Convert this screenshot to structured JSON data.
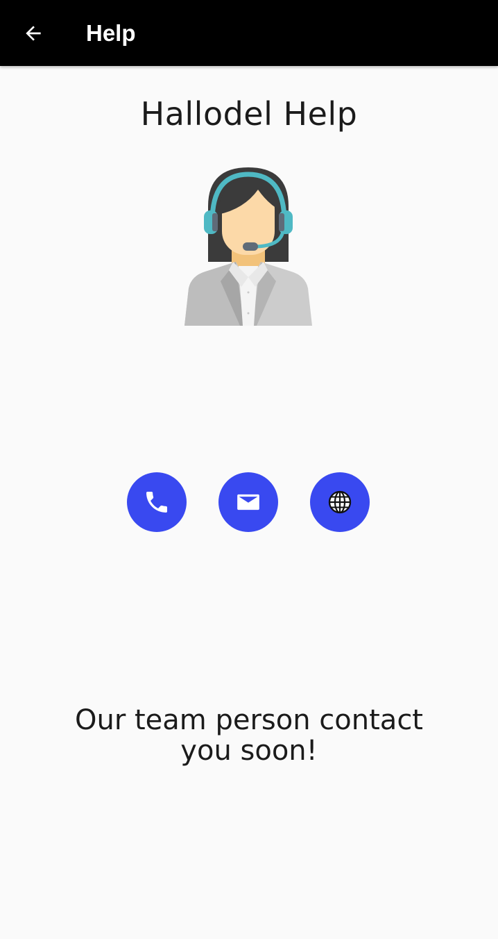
{
  "app_bar": {
    "title": "Help",
    "back_icon": "arrow-left-icon",
    "background": "#000000"
  },
  "page": {
    "title": "Hallodel Help",
    "illustration": "support-agent-with-headset",
    "message_line1": "Our team person contact",
    "message_line2": "you soon!"
  },
  "contact_actions": [
    {
      "icon": "phone-icon",
      "color": "#3949f0"
    },
    {
      "icon": "mail-icon",
      "color": "#3949f0"
    },
    {
      "icon": "globe-icon",
      "color": "#3949f0"
    }
  ]
}
